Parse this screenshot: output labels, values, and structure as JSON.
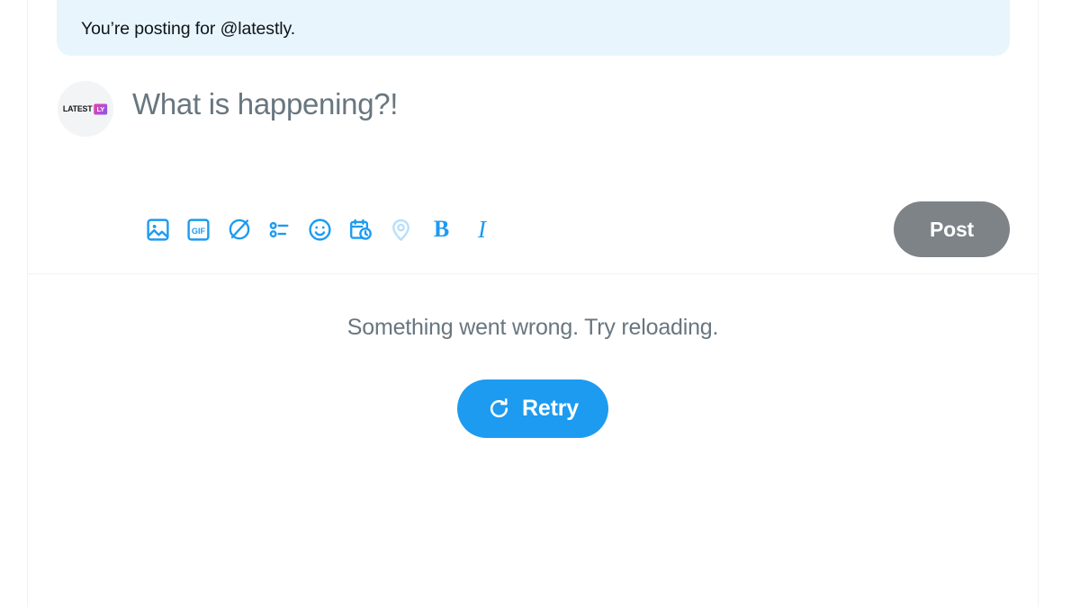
{
  "banner": {
    "text": "You’re posting for @latestly.",
    "background_color": "#e8f5fd"
  },
  "composer": {
    "avatar": {
      "name": "latestly-avatar",
      "logo_word": "LATEST",
      "logo_badge": "LY"
    },
    "placeholder": "What is happening?!",
    "toolbar": {
      "items": [
        {
          "icon": "image-icon",
          "label": "Media",
          "state": "enabled"
        },
        {
          "icon": "gif-icon",
          "label": "GIF",
          "state": "enabled"
        },
        {
          "icon": "grok-imagine-icon",
          "label": "Grok imagine",
          "state": "enabled"
        },
        {
          "icon": "poll-icon",
          "label": "Poll",
          "state": "enabled"
        },
        {
          "icon": "emoji-icon",
          "label": "Emoji",
          "state": "enabled"
        },
        {
          "icon": "schedule-icon",
          "label": "Schedule post",
          "state": "enabled"
        },
        {
          "icon": "location-pin-icon",
          "label": "Tag location",
          "state": "disabled"
        },
        {
          "icon": "bold-icon",
          "label": "B",
          "state": "enabled"
        },
        {
          "icon": "italic-icon",
          "label": "I",
          "state": "enabled"
        }
      ]
    },
    "post_button": {
      "label": "Post",
      "state": "disabled",
      "color": "#7e8387"
    }
  },
  "error_state": {
    "message": "Something went wrong. Try reloading.",
    "retry_label": "Retry",
    "retry_icon": "refresh-icon",
    "retry_color": "#1d9bf0"
  },
  "theme": {
    "accent": "#1d9bf0",
    "text_primary": "#0f1419",
    "text_secondary": "#68767f",
    "border": "#eff3f4",
    "background": "#ffffff"
  }
}
